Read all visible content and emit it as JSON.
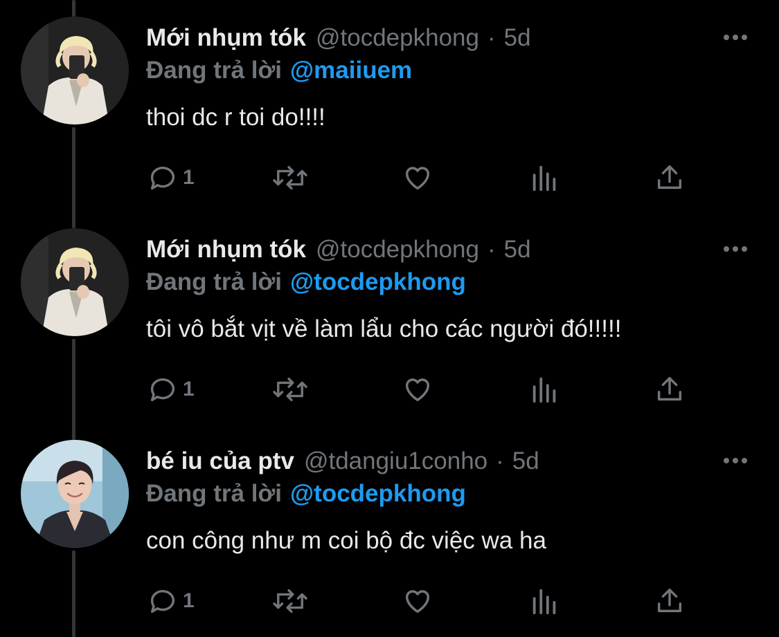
{
  "colors": {
    "background": "#000000",
    "text_primary": "#e7e9ea",
    "text_secondary": "#71767b",
    "accent": "#1d9bf0",
    "thread_line": "#333639"
  },
  "tweets": [
    {
      "display_name": "Mới nhụm tók",
      "handle": "@tocdepkhong",
      "dot": "·",
      "time": "5d",
      "reply_prefix": "Đang trả lời",
      "reply_to": "@maiiuem",
      "text": "thoi dc r toi do!!!!",
      "reply_count": "1",
      "avatar": "blonde-person-mirror-selfie-white-suit",
      "icons": [
        "more-icon",
        "reply-icon",
        "retweet-icon",
        "like-icon",
        "views-icon",
        "share-icon"
      ]
    },
    {
      "display_name": "Mới nhụm tók",
      "handle": "@tocdepkhong",
      "dot": "·",
      "time": "5d",
      "reply_prefix": "Đang trả lời",
      "reply_to": "@tocdepkhong",
      "text": "tôi vô bắt vịt về làm lẩu cho các người đó!!!!!",
      "reply_count": "1",
      "avatar": "blonde-person-mirror-selfie-white-suit",
      "icons": [
        "more-icon",
        "reply-icon",
        "retweet-icon",
        "like-icon",
        "views-icon",
        "share-icon"
      ]
    },
    {
      "display_name": "bé iu của ptv",
      "handle": "@tdangiu1conho",
      "dot": "·",
      "time": "5d",
      "reply_prefix": "Đang trả lời",
      "reply_to": "@tocdepkhong",
      "text": "con công như m coi bộ đc việc wa ha",
      "reply_count": "1",
      "avatar": "smiling-person-dark-cardigan",
      "icons": [
        "more-icon",
        "reply-icon",
        "retweet-icon",
        "like-icon",
        "views-icon",
        "share-icon"
      ]
    }
  ]
}
